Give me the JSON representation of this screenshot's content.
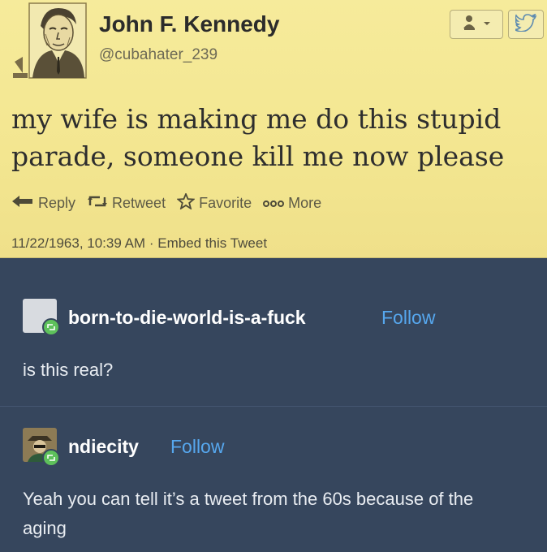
{
  "tweet": {
    "name": "John F. Kennedy",
    "handle": "@cubahater_239",
    "text": "my wife is making me do this stupid parade, someone kill me now please",
    "actions": {
      "reply": "Reply",
      "retweet": "Retweet",
      "favorite": "Favorite",
      "more": "More"
    },
    "timestamp": "11/22/1963, 10:39 AM",
    "meta_separator": "·",
    "embed": "Embed this Tweet",
    "follow_icon": "user-follow-icon",
    "platform_icon": "twitter-bird-icon"
  },
  "replies": [
    {
      "username": "born-to-die-world-is-a-fuck",
      "follow_label": "Follow",
      "text": "is this real?"
    },
    {
      "username": "ndiecity",
      "follow_label": "Follow",
      "text": "Yeah you can tell it’s a tweet from the 60s because of the aging"
    }
  ],
  "colors": {
    "tweet_bg": "#f6eb9b",
    "tumblr_bg": "#36465d",
    "follow_link": "#56a7ee",
    "reblog_badge": "#5ec15b"
  }
}
